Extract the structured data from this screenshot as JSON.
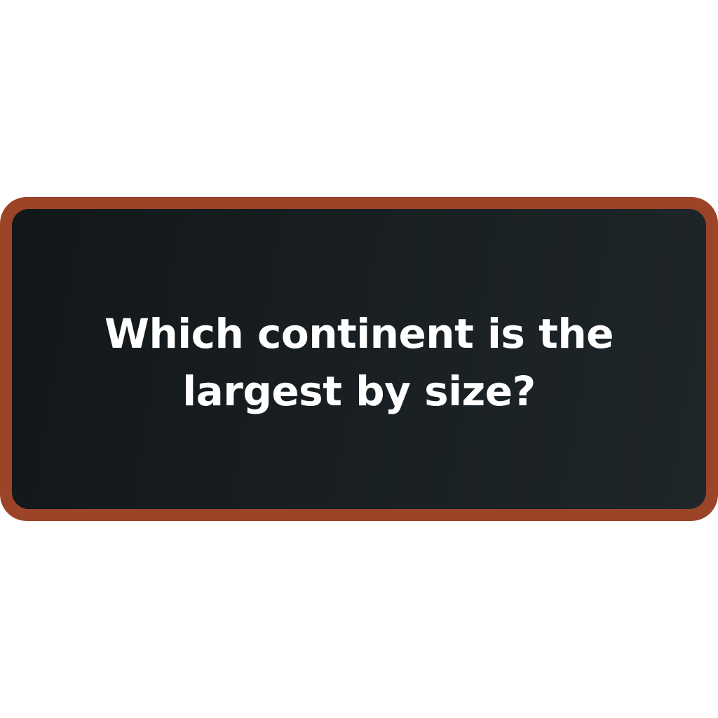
{
  "question_card": {
    "question": "Which continent is the largest by size?"
  },
  "colors": {
    "border": "#9c4428",
    "background_dark": "#12171a",
    "background_light": "#1f2629",
    "text": "#ffffff",
    "page_background": "#ffffff"
  }
}
